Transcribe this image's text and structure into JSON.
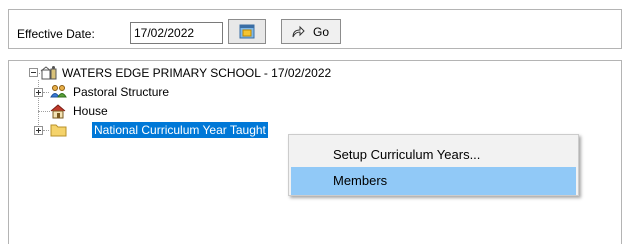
{
  "toolbar": {
    "effective_date_label": "Effective Date:",
    "effective_date_value": "17/02/2022",
    "go_label": "Go"
  },
  "tree": {
    "root_label": "WATERS EDGE PRIMARY SCHOOL - 17/02/2022",
    "children": [
      {
        "label": "Pastoral Structure",
        "icon": "people-icon",
        "expandable": true,
        "selected": false
      },
      {
        "label": "House",
        "icon": "house-icon",
        "expandable": false,
        "selected": false
      },
      {
        "label": "National Curriculum Year Taught",
        "icon": "folder-icon",
        "expandable": true,
        "selected": true
      }
    ]
  },
  "context_menu": {
    "items": [
      {
        "label": "Setup Curriculum Years...",
        "highlighted": false
      },
      {
        "label": "Members",
        "highlighted": true
      }
    ]
  },
  "colors": {
    "selection": "#0078d7",
    "menu_highlight": "#91c9f7",
    "menu_background": "#f2f2f2"
  }
}
